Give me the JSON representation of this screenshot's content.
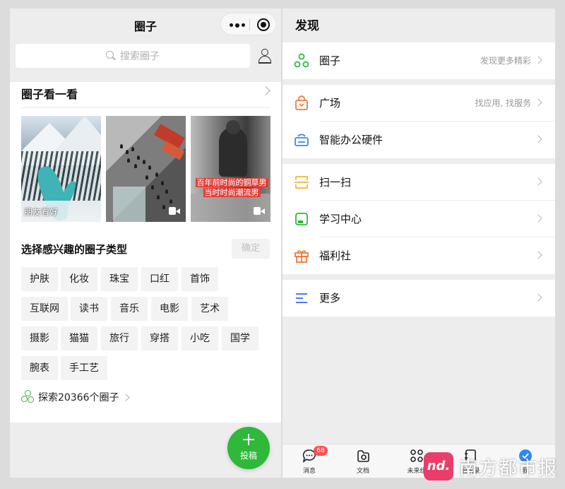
{
  "left": {
    "title": "圈子",
    "search_placeholder": "搜索圈子",
    "section_title": "圈子看一看",
    "thumbs": [
      {
        "caption": "朋友看好"
      },
      {
        "caption": ""
      },
      {
        "caption_line1": "百年前时尚的铜草男",
        "caption_line2": "当时时尚潮流男"
      }
    ],
    "choose_title": "选择感兴趣的圈子类型",
    "confirm_label": "确定",
    "chips": [
      "护肤",
      "化妆",
      "珠宝",
      "口红",
      "首饰",
      "互联网",
      "读书",
      "音乐",
      "电影",
      "艺术",
      "摄影",
      "猫猫",
      "旅行",
      "穿搭",
      "小吃",
      "国学",
      "腕表",
      "手工艺"
    ],
    "explore_text": "探索20366个圈子",
    "post_label": "投稿"
  },
  "right": {
    "title": "发现",
    "rows": [
      {
        "label": "圈子",
        "sub": "发现更多精彩",
        "icon": "circle-network-icon",
        "color": "#2fb83a"
      },
      {
        "label": "广场",
        "sub": "找应用, 找服务",
        "icon": "shopping-bag-icon",
        "color": "#f0793a"
      },
      {
        "label": "智能办公硬件",
        "sub": "",
        "icon": "office-device-icon",
        "color": "#3a8af0"
      },
      {
        "label": "扫一扫",
        "sub": "",
        "icon": "scan-icon",
        "color": "#f0b43a"
      },
      {
        "label": "学习中心",
        "sub": "",
        "icon": "study-icon",
        "color": "#2fb83a"
      },
      {
        "label": "福利社",
        "sub": "",
        "icon": "gift-icon",
        "color": "#f0793a"
      },
      {
        "label": "更多",
        "sub": "",
        "icon": "menu-lines-icon",
        "color": "#3a6af0"
      }
    ],
    "tabs": [
      {
        "label": "消息",
        "icon": "message-icon",
        "badge": "68"
      },
      {
        "label": "文档",
        "icon": "document-icon",
        "badge": ""
      },
      {
        "label": "未来组",
        "icon": "grid-icon",
        "badge": ""
      },
      {
        "label": "通讯录",
        "icon": "contacts-icon",
        "badge": ""
      },
      {
        "label": "我",
        "icon": "me-icon",
        "badge": ""
      }
    ]
  },
  "watermark": {
    "logo": "nd.",
    "text": "南方都市报"
  }
}
